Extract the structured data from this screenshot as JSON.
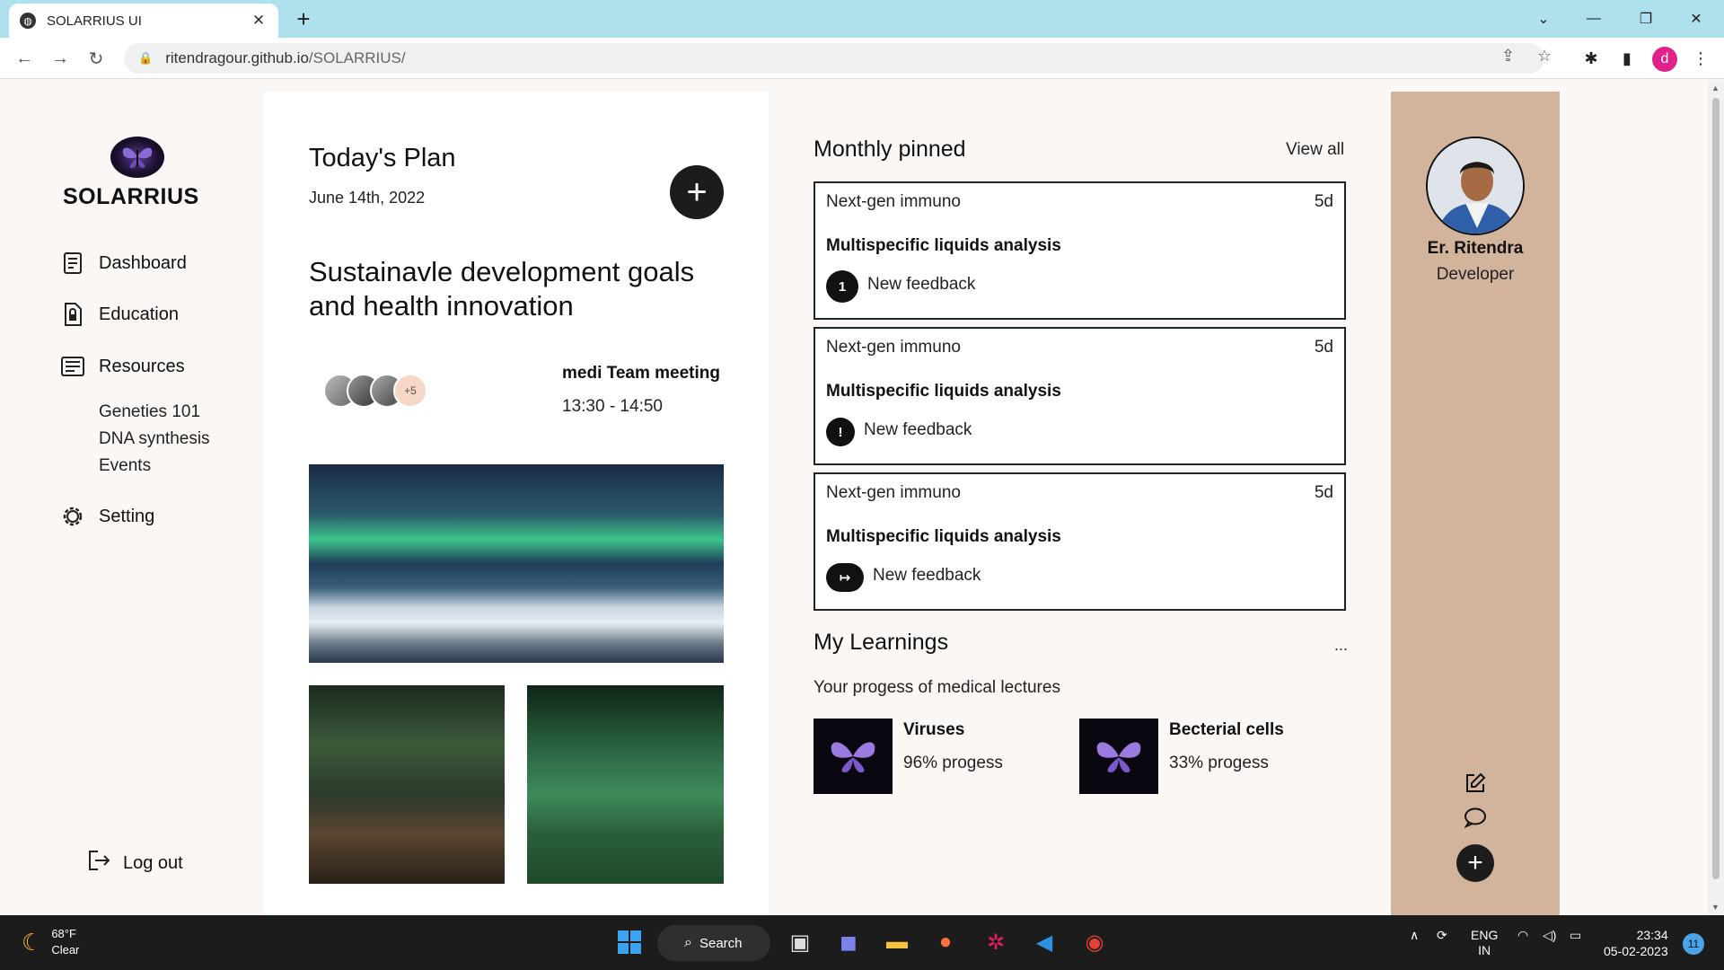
{
  "browser": {
    "tab_title": "SOLARRIUS UI",
    "tab_close": "✕",
    "new_tab": "+",
    "url_host": "ritendragour.github.io",
    "url_path": "/SOLARRIUS/",
    "profile_initial": "d"
  },
  "sidebar": {
    "brand": "SOLARRIUS",
    "nav": [
      {
        "label": "Dashboard",
        "icon": "document-list-icon"
      },
      {
        "label": "Education",
        "icon": "lock-file-icon"
      },
      {
        "label": "Resources",
        "icon": "notes-icon"
      }
    ],
    "resources_sub": [
      "Geneties 101",
      "DNA synthesis",
      "Events"
    ],
    "setting": "Setting",
    "logout": "Log out"
  },
  "plan": {
    "title": "Today's Plan",
    "date": "June 14th, 2022",
    "add_label": "+",
    "heading": "Sustainavle development goals and health innovation",
    "avatars_more": "+5",
    "meeting_title": "medi Team meeting",
    "meeting_time": "13:30 - 14:50"
  },
  "pinned": {
    "title": "Monthly pinned",
    "view_all": "View all",
    "cards": [
      {
        "category": "Next-gen immuno",
        "days": "5d",
        "title": "Multispecific liquids analysis",
        "badge": "1",
        "feedback": "New feedback"
      },
      {
        "category": "Next-gen immuno",
        "days": "5d",
        "title": "Multispecific liquids analysis",
        "badge": "!",
        "feedback": "New feedback"
      },
      {
        "category": "Next-gen immuno",
        "days": "5d",
        "title": "Multispecific liquids analysis",
        "badge": "↦",
        "feedback": "New feedback"
      }
    ]
  },
  "learnings": {
    "title": "My Learnings",
    "more": "...",
    "subtitle": "Your progess of medical lectures",
    "items": [
      {
        "name": "Viruses",
        "progress": "96% progess",
        "progress_value": 0.96
      },
      {
        "name": "Becterial cells",
        "progress": "33% progess",
        "progress_value": 0.33
      }
    ]
  },
  "profile": {
    "name": "Er. Ritendra",
    "role": "Developer",
    "plus": "+"
  },
  "taskbar": {
    "temp": "68°F",
    "condition": "Clear",
    "search": "Search",
    "lang": "ENG",
    "region": "IN",
    "time": "23:34",
    "date": "05-02-2023",
    "notifications": "11"
  },
  "colors": {
    "page_bg": "#faf7f5",
    "profile_panel": "#d2b39c",
    "tabbar": "#aee0ee",
    "dark": "#1c1c1c"
  }
}
